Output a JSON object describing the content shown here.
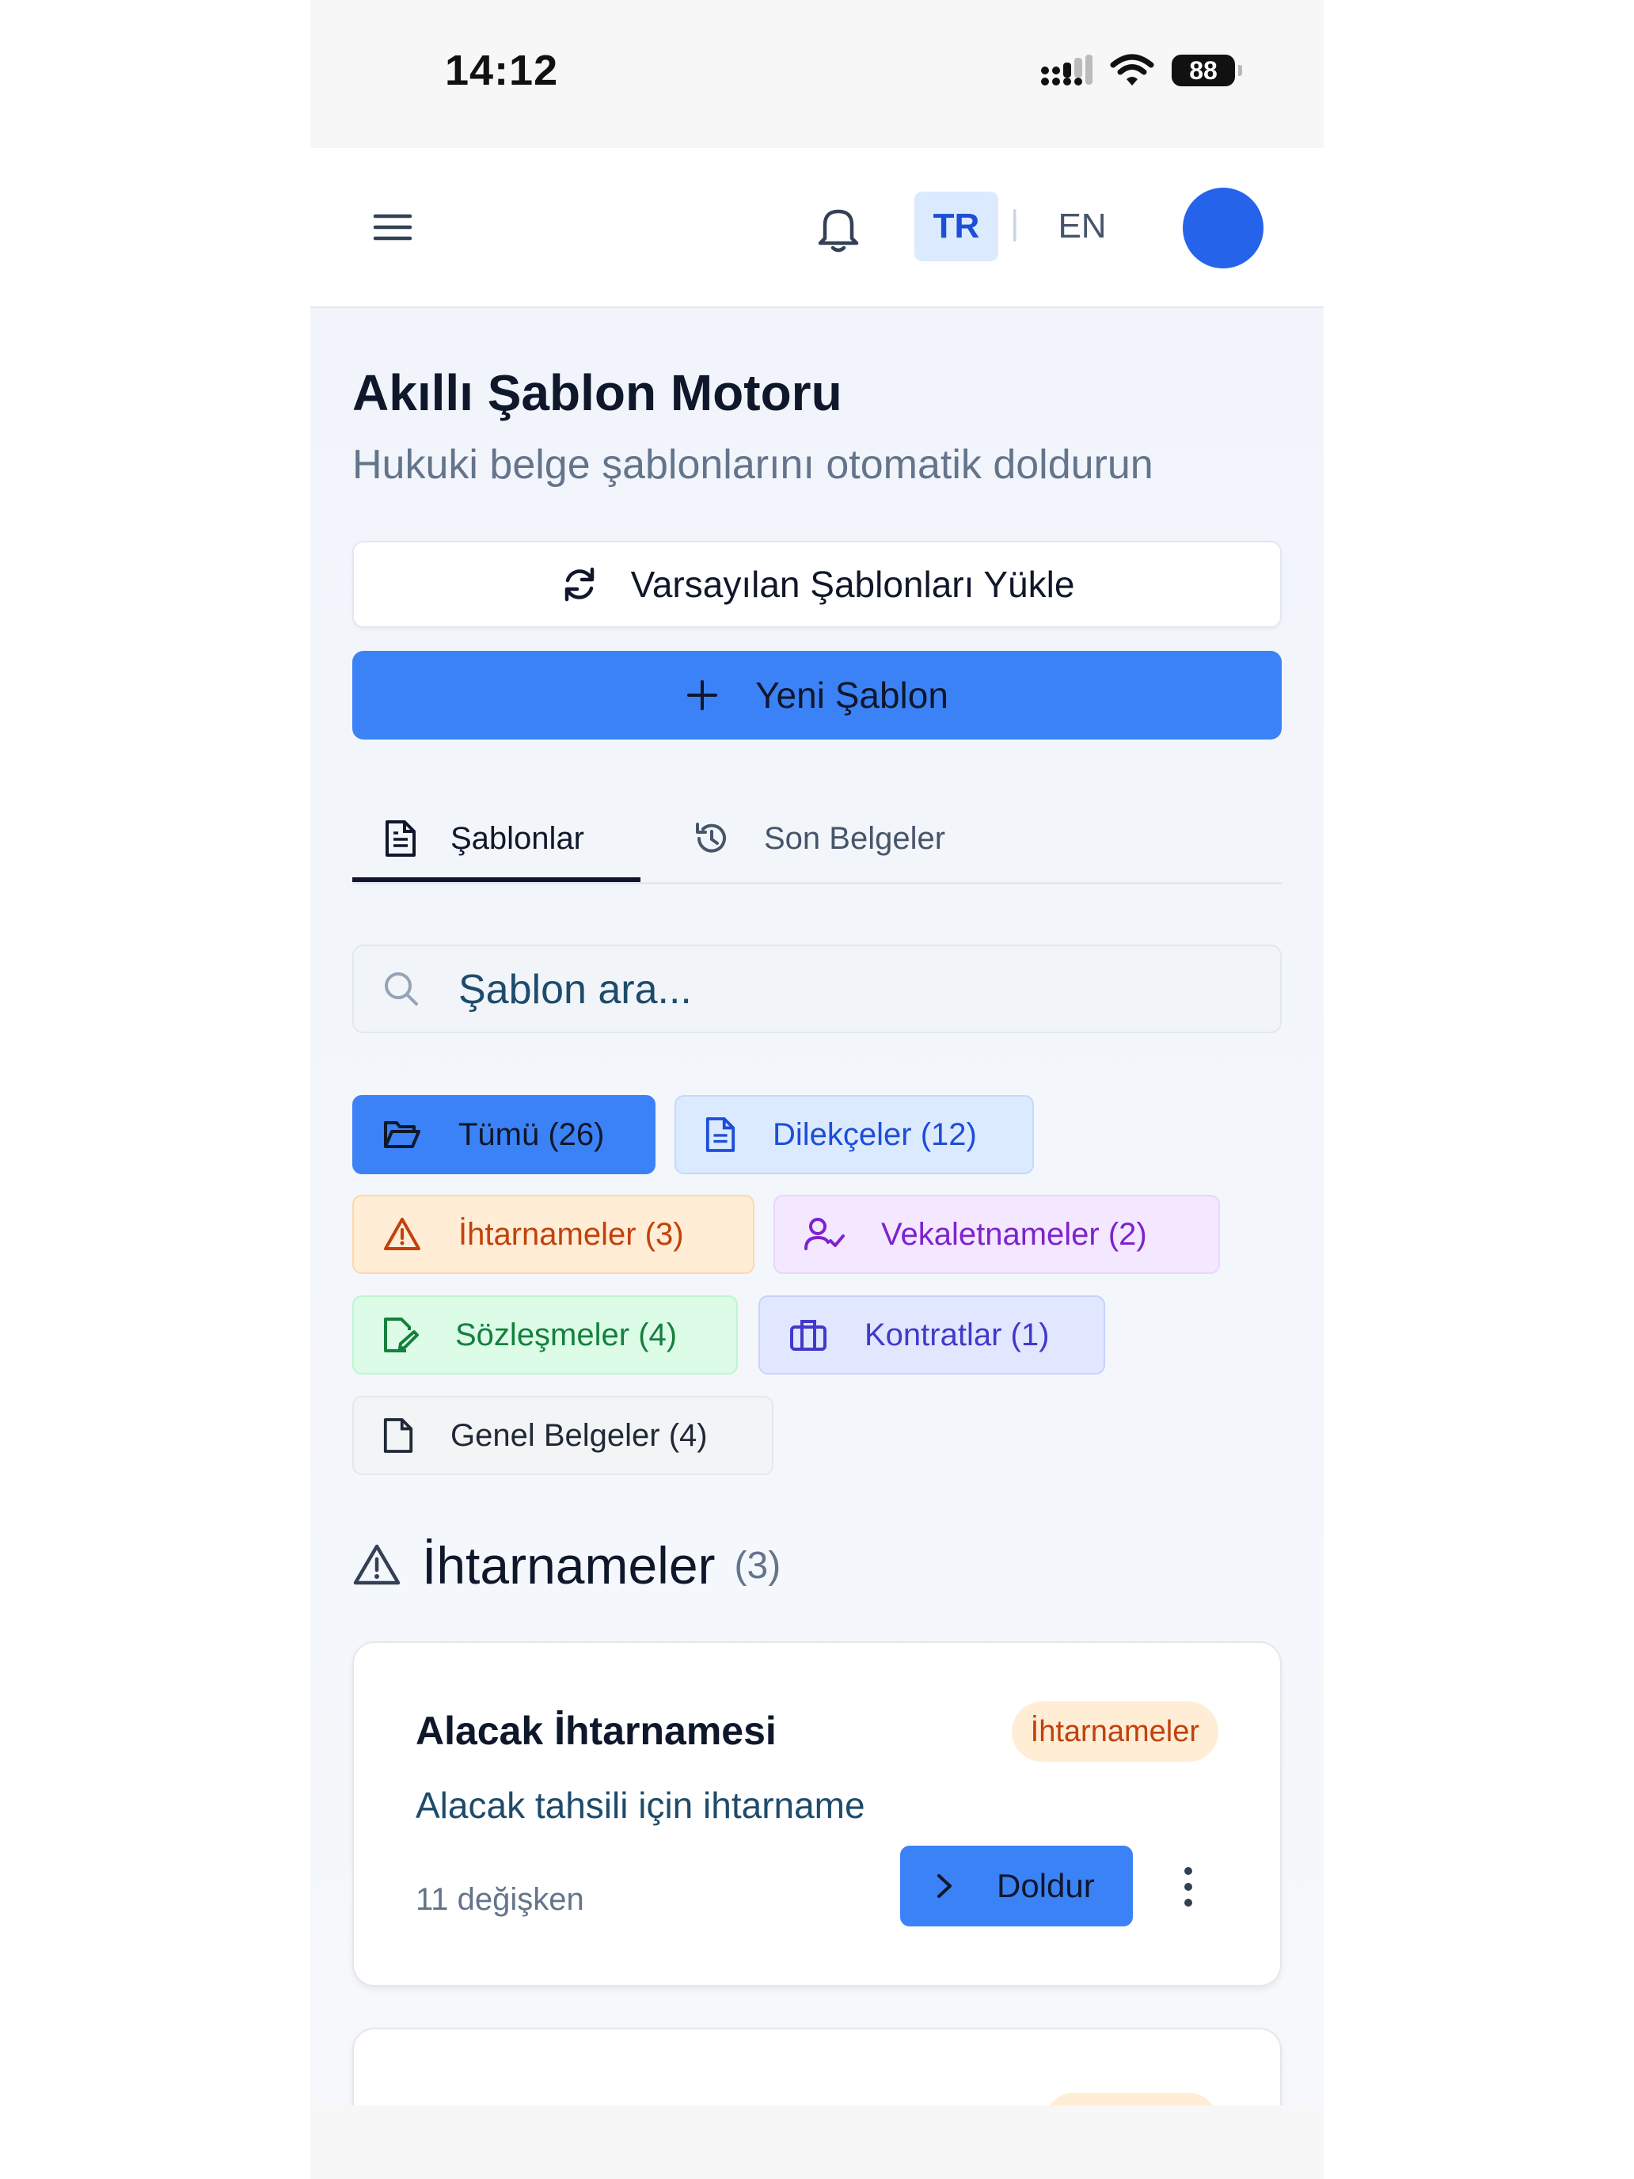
{
  "status_bar": {
    "time": "14:12",
    "battery": "88"
  },
  "header": {
    "lang_tr": "TR",
    "lang_sep": "|",
    "lang_en": "EN"
  },
  "page": {
    "title": "Akıllı Şablon Motoru",
    "subtitle": "Hukuki belge şablonlarını otomatik doldurun",
    "load_defaults_label": "Varsayılan Şablonları Yükle",
    "new_template_label": "Yeni Şablon"
  },
  "tabs": [
    {
      "label": "Şablonlar",
      "active": true
    },
    {
      "label": "Son Belgeler",
      "active": false
    }
  ],
  "search": {
    "placeholder": "Şablon ara..."
  },
  "filters": [
    {
      "label": "Tümü (26)",
      "icon": "folder-open-icon",
      "active": true
    },
    {
      "label": "Dilekçeler (12)",
      "icon": "file-text-icon"
    },
    {
      "label": "İhtarnameler (3)",
      "icon": "warning-icon"
    },
    {
      "label": "Vekaletnameler (2)",
      "icon": "user-check-icon"
    },
    {
      "label": "Sözleşmeler (4)",
      "icon": "file-signature-icon"
    },
    {
      "label": "Kontratlar (1)",
      "icon": "briefcase-icon"
    },
    {
      "label": "Genel Belgeler (4)",
      "icon": "file-icon"
    }
  ],
  "section": {
    "title": "İhtarnameler",
    "count": "(3)"
  },
  "cards": [
    {
      "title": "Alacak İhtarnamesi",
      "badge": "İhtarnameler",
      "description": "Alacak tahsili için ihtarname",
      "variables": "11 değişken",
      "fill_label": "Doldur"
    }
  ],
  "colors": {
    "primary": "#3b82f6",
    "avatar": "#2563eb",
    "warning": "#c2410c"
  }
}
